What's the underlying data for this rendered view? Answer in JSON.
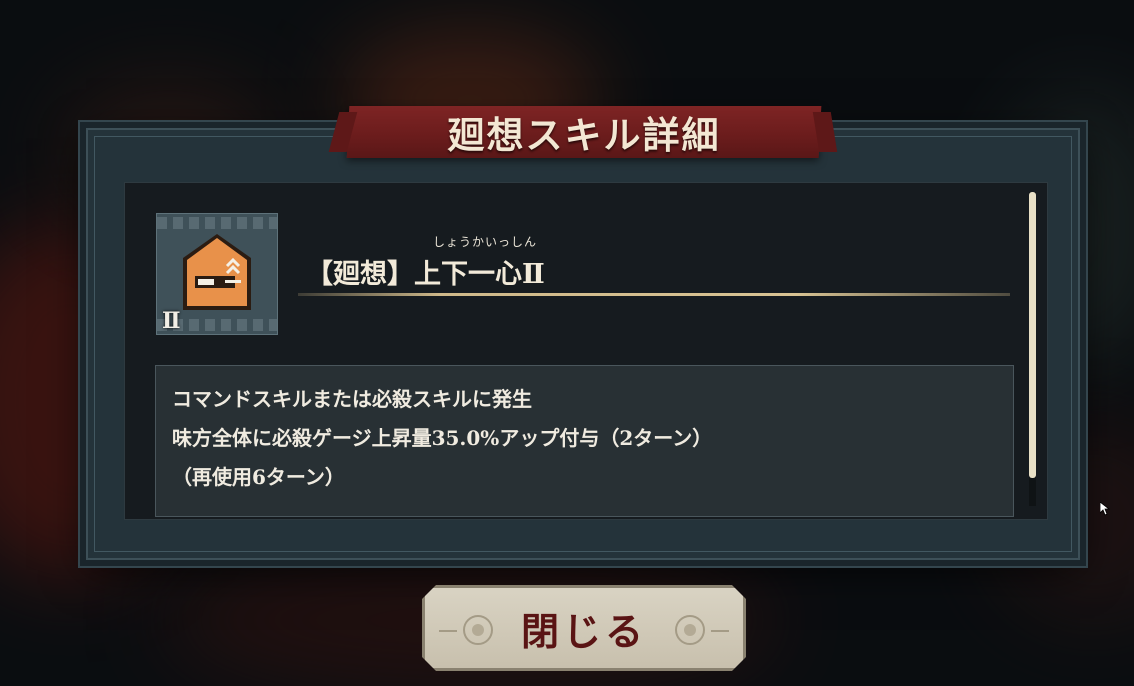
{
  "dialog": {
    "title": "廻想スキル詳細"
  },
  "skill": {
    "icon": "turn-gauge-up-icon",
    "level_mark": "Ⅱ",
    "ruby": "しょうかいっしん",
    "name": "【廻想】上下一心Ⅱ",
    "description": [
      "コマンドスキルまたは必殺スキルに発生",
      "味方全体に必殺ゲージ上昇量35.0%アップ付与（2ターン）",
      "（再使用6ターン）"
    ],
    "icon_color": "#e8914a"
  },
  "buttons": {
    "close_label": "閉じる"
  },
  "colors": {
    "banner": "#7e2424",
    "frame": "#24333a",
    "button_text": "#5a1414"
  }
}
